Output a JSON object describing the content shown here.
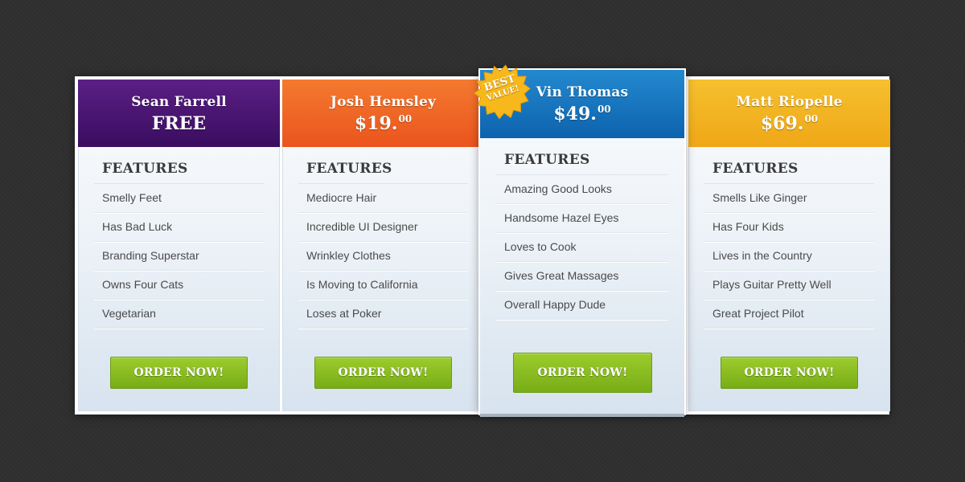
{
  "plans": [
    {
      "name": "Sean Farrell",
      "price_main": "FREE",
      "price_cents": "",
      "features_title": "FEATURES",
      "features": [
        "Smelly Feet",
        "Has Bad Luck",
        "Branding Superstar",
        "Owns Four Cats",
        "Vegetarian"
      ],
      "button_label": "ORDER NOW!",
      "header_color": "#4a1670"
    },
    {
      "name": "Josh Hemsley",
      "price_main": "$19.",
      "price_cents": "00",
      "features_title": "FEATURES",
      "features": [
        "Mediocre Hair",
        "Incredible UI Designer",
        "Wrinkley Clothes",
        "Is Moving to California",
        "Loses at Poker"
      ],
      "button_label": "ORDER NOW!",
      "header_color": "#ef6525"
    },
    {
      "name": "Vin Thomas",
      "price_main": "$49.",
      "price_cents": "00",
      "features_title": "FEATURES",
      "features": [
        "Amazing Good Looks",
        "Handsome Hazel Eyes",
        "Loves to Cook",
        "Gives Great Massages",
        "Overall Happy Dude"
      ],
      "button_label": "ORDER NOW!",
      "header_color": "#1874be",
      "badge_line1": "BEST",
      "badge_line2": "VALUE!",
      "badge_color": "#f6b81a"
    },
    {
      "name": "Matt Riopelle",
      "price_main": "$69.",
      "price_cents": "00",
      "features_title": "FEATURES",
      "features": [
        "Smells Like Ginger",
        "Has Four Kids",
        "Lives in the Country",
        "Plays Guitar Pretty Well",
        "Great Project Pilot"
      ],
      "button_label": "ORDER NOW!",
      "header_color": "#f2b322"
    }
  ],
  "colors": {
    "background": "#2f2f2f",
    "button_green": "#86bc20",
    "feature_text": "#4a4a4a"
  }
}
